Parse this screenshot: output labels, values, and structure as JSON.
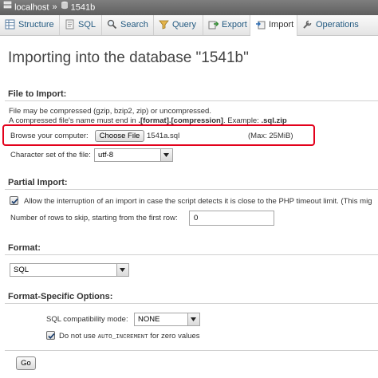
{
  "breadcrumb": {
    "server": "localhost",
    "separator": "»",
    "database": "1541b"
  },
  "tabs": [
    {
      "label": "Structure",
      "icon": "structure-icon"
    },
    {
      "label": "SQL",
      "icon": "sql-icon"
    },
    {
      "label": "Search",
      "icon": "search-icon"
    },
    {
      "label": "Query",
      "icon": "query-icon"
    },
    {
      "label": "Export",
      "icon": "export-icon"
    },
    {
      "label": "Import",
      "icon": "import-icon",
      "active": true
    },
    {
      "label": "Operations",
      "icon": "operations-icon"
    }
  ],
  "page_title": "Importing into the database \"1541b\"",
  "file_section": {
    "title": "File to Import:",
    "compress_note": "File may be compressed (gzip, bzip2, zip) or uncompressed.",
    "name_note_prefix": "A compressed file's name must end in ",
    "name_note_format": ".[format].[compression]",
    "name_note_example_label": ". Example: ",
    "name_note_example": ".sql.zip",
    "browse_label": "Browse your computer:",
    "choose_file_button": "Choose File",
    "chosen_file": "1541a.sql",
    "max_size": "(Max: 25MiB)",
    "charset_label": "Character set of the file:",
    "charset_value": "utf-8"
  },
  "partial_section": {
    "title": "Partial Import:",
    "allow_interrupt_label": "Allow the interruption of an import in case the script detects it is close to the PHP timeout limit. (This mig",
    "allow_interrupt_checked": true,
    "skip_rows_label": "Number of rows to skip, starting from the first row:",
    "skip_rows_value": "0"
  },
  "format_section": {
    "title": "Format:",
    "format_value": "SQL"
  },
  "options_section": {
    "title": "Format-Specific Options:",
    "compat_label": "SQL compatibility mode:",
    "compat_value": "NONE",
    "no_auto_inc_prefix": "Do not use ",
    "no_auto_inc_code": "AUTO_INCREMENT",
    "no_auto_inc_suffix": " for zero values",
    "no_auto_inc_checked": true
  },
  "go_button": "Go",
  "colors": {
    "highlight": "#e3001b",
    "link": "#235a81",
    "breadcrumb_bg": "#6f6f6f"
  }
}
